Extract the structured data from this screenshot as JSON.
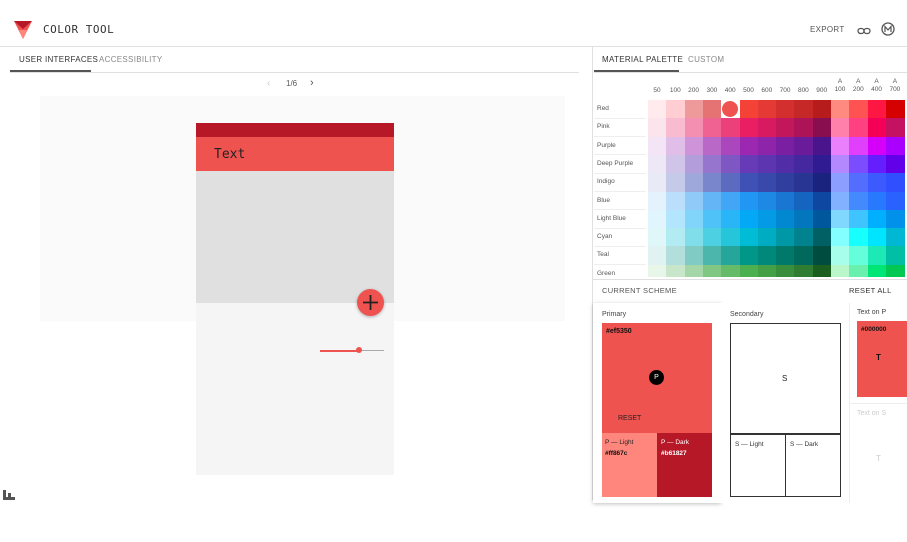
{
  "app": {
    "title": "COLOR TOOL",
    "export_label": "EXPORT",
    "link_icon": "link-icon",
    "profile_icon": "material-m-icon"
  },
  "left_tabs": [
    {
      "label": "USER INTERFACES",
      "active": true
    },
    {
      "label": "ACCESSIBILITY",
      "active": false
    }
  ],
  "pager": {
    "text": "1/6"
  },
  "preview": {
    "app_bar_text": "Text",
    "fab_icon": "plus-icon",
    "primary": "#ef5350",
    "primary_dark": "#b61827"
  },
  "right_tabs": [
    {
      "label": "MATERIAL PALETTE",
      "active": true
    },
    {
      "label": "CUSTOM",
      "active": false
    }
  ],
  "palette": {
    "columns": [
      "50",
      "100",
      "200",
      "300",
      "400",
      "500",
      "600",
      "700",
      "800",
      "900",
      "A\n100",
      "A\n200",
      "A\n400",
      "A\n700"
    ],
    "rows": [
      {
        "name": "Red",
        "colors": [
          "#ffebee",
          "#ffcdd2",
          "#ef9a9a",
          "#e57373",
          "#ef5350",
          "#f44336",
          "#e53935",
          "#d32f2f",
          "#c62828",
          "#b71c1c",
          "#ff8a80",
          "#ff5252",
          "#ff1744",
          "#d50000"
        ]
      },
      {
        "name": "Pink",
        "colors": [
          "#fce4ec",
          "#f8bbd0",
          "#f48fb1",
          "#f06292",
          "#ec407a",
          "#e91e63",
          "#d81b60",
          "#c2185b",
          "#ad1457",
          "#880e4f",
          "#ff80ab",
          "#ff4081",
          "#f50057",
          "#c51162"
        ]
      },
      {
        "name": "Purple",
        "colors": [
          "#f3e5f5",
          "#e1bee7",
          "#ce93d8",
          "#ba68c8",
          "#ab47bc",
          "#9c27b0",
          "#8e24aa",
          "#7b1fa2",
          "#6a1b9a",
          "#4a148c",
          "#ea80fc",
          "#e040fb",
          "#d500f9",
          "#aa00ff"
        ]
      },
      {
        "name": "Deep Purple",
        "colors": [
          "#ede7f6",
          "#d1c4e9",
          "#b39ddb",
          "#9575cd",
          "#7e57c2",
          "#673ab7",
          "#5e35b1",
          "#512da8",
          "#4527a0",
          "#311b92",
          "#b388ff",
          "#7c4dff",
          "#651fff",
          "#6200ea"
        ]
      },
      {
        "name": "Indigo",
        "colors": [
          "#e8eaf6",
          "#c5cae9",
          "#9fa8da",
          "#7986cb",
          "#5c6bc0",
          "#3f51b5",
          "#3949ab",
          "#303f9f",
          "#283593",
          "#1a237e",
          "#8c9eff",
          "#536dfe",
          "#3d5afe",
          "#304ffe"
        ]
      },
      {
        "name": "Blue",
        "colors": [
          "#e3f2fd",
          "#bbdefb",
          "#90caf9",
          "#64b5f6",
          "#42a5f5",
          "#2196f3",
          "#1e88e5",
          "#1976d2",
          "#1565c0",
          "#0d47a1",
          "#82b1ff",
          "#448aff",
          "#2979ff",
          "#2962ff"
        ]
      },
      {
        "name": "Light Blue",
        "colors": [
          "#e1f5fe",
          "#b3e5fc",
          "#81d4fa",
          "#4fc3f7",
          "#29b6f6",
          "#03a9f4",
          "#039be5",
          "#0288d1",
          "#0277bd",
          "#01579b",
          "#80d8ff",
          "#40c4ff",
          "#00b0ff",
          "#0091ea"
        ]
      },
      {
        "name": "Cyan",
        "colors": [
          "#e0f7fa",
          "#b2ebf2",
          "#80deea",
          "#4dd0e1",
          "#26c6da",
          "#00bcd4",
          "#00acc1",
          "#0097a7",
          "#00838f",
          "#006064",
          "#84ffff",
          "#18ffff",
          "#00e5ff",
          "#00b8d4"
        ]
      },
      {
        "name": "Teal",
        "colors": [
          "#e0f2f1",
          "#b2dfdb",
          "#80cbc4",
          "#4db6ac",
          "#26a69a",
          "#009688",
          "#00897b",
          "#00796b",
          "#00695c",
          "#004d40",
          "#a7ffeb",
          "#64ffda",
          "#1de9b6",
          "#00bfa5"
        ]
      },
      {
        "name": "Green",
        "colors": [
          "#e8f5e9",
          "#c8e6c9",
          "#a5d6a7",
          "#81c784",
          "#66bb6a",
          "#4caf50",
          "#43a047",
          "#388e3c",
          "#2e7d32",
          "#1b5e20",
          "#b9f6ca",
          "#69f0ae",
          "#00e676",
          "#00c853"
        ]
      }
    ]
  },
  "scheme": {
    "title": "CURRENT SCHEME",
    "reset_all": "RESET ALL",
    "primary": {
      "label": "Primary",
      "hex": "#ef5350",
      "badge": "P",
      "reset": "RESET",
      "light_label": "P — Light",
      "light_hex": "#ff867c",
      "dark_label": "P — Dark",
      "dark_hex": "#b61827"
    },
    "secondary": {
      "label": "Secondary",
      "badge": "S",
      "light_label": "S — Light",
      "dark_label": "S — Dark"
    },
    "text_on_p": {
      "label": "Text on P",
      "hex": "#000000",
      "badge": "T"
    },
    "text_on_s": {
      "label": "Text on S",
      "badge": "T"
    }
  }
}
